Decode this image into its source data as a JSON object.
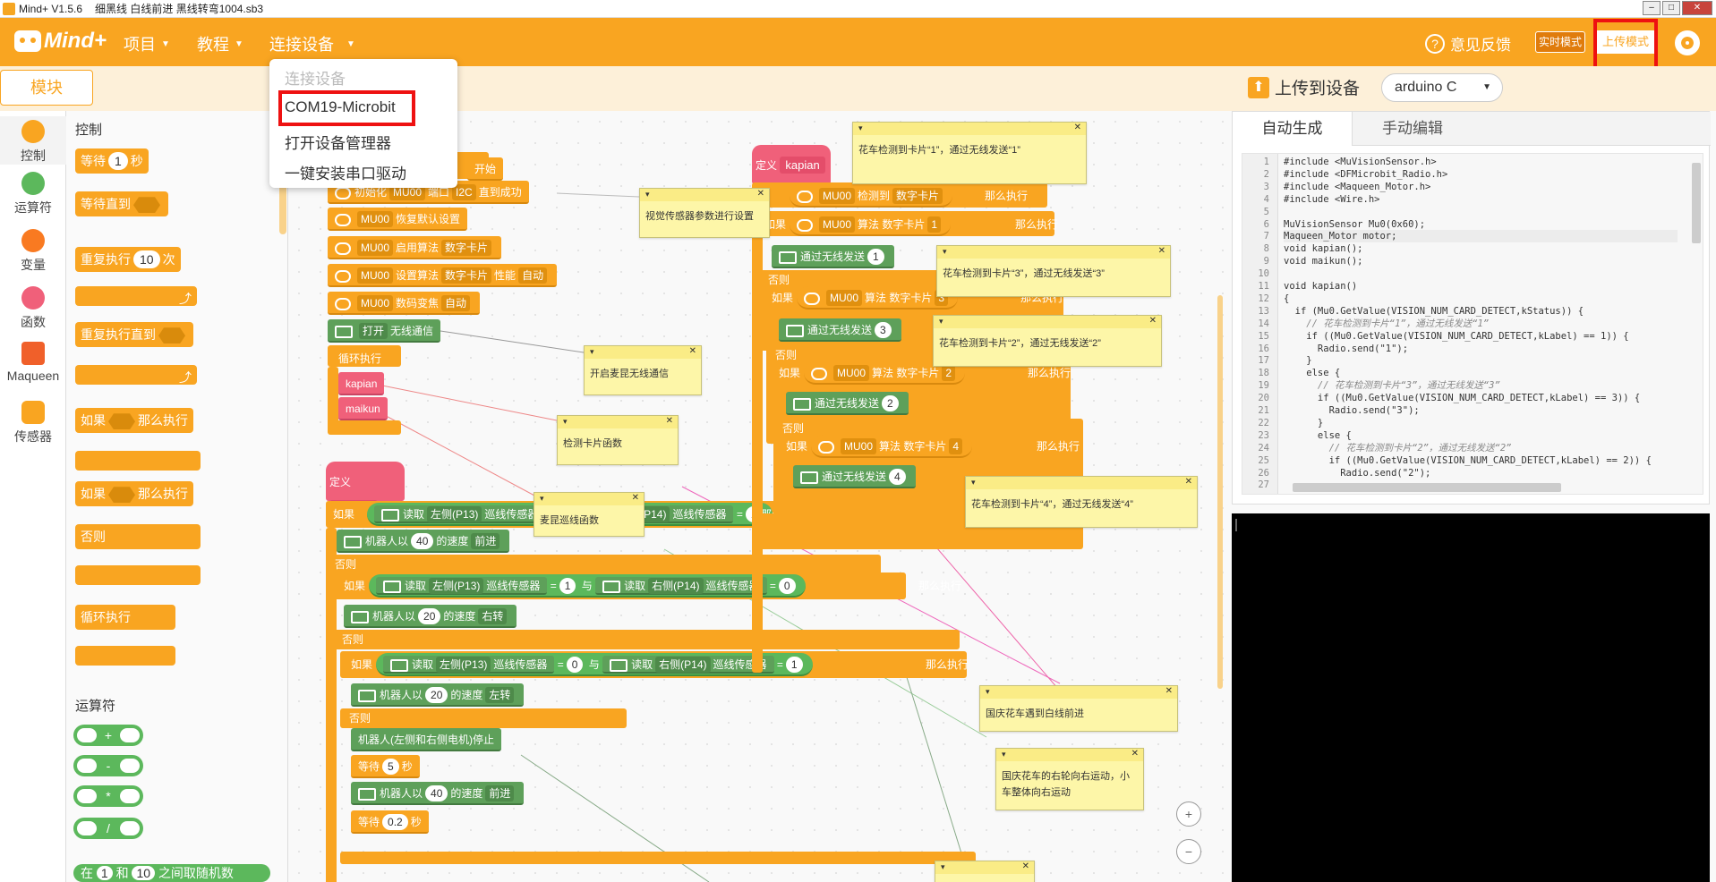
{
  "window": {
    "app": "Mind+ V1.5.6",
    "file": "细黑线 白线前进 黑线转弯1004.sb3"
  },
  "topbar": {
    "logo": "Mind+",
    "menus": [
      "项目",
      "教程",
      "连接设备"
    ],
    "feedback": "意见反馈",
    "mode_realtime": "实时模式",
    "mode_upload": "上传模式"
  },
  "subbar": {
    "module_tab": "模块",
    "upload_label": "上传到设备",
    "device": "arduino C"
  },
  "device_menu": {
    "items": [
      "连接设备",
      "COM19-Microbit",
      "打开设备管理器",
      "一键安装串口驱动"
    ]
  },
  "categories": [
    {
      "label": "控制",
      "color": "#f9a521"
    },
    {
      "label": "运算符",
      "color": "#5cb85c"
    },
    {
      "label": "变量",
      "color": "#f97a21"
    },
    {
      "label": "函数",
      "color": "#f0607a"
    },
    {
      "label": "Maqueen",
      "color": "#f0602a"
    },
    {
      "label": "传感器",
      "color": "#f9a521"
    }
  ],
  "palette": {
    "control_title": "控制",
    "wait": "等待",
    "wait_val": "1",
    "wait_unit": "秒",
    "wait_until": "等待直到",
    "repeat": "重复执行",
    "repeat_val": "10",
    "repeat_unit": "次",
    "repeat_until": "重复执行直到",
    "if_then": "如果",
    "then": "那么执行",
    "if_else_if": "如果",
    "if_else_then": "那么执行",
    "else": "否则",
    "forever": "循环执行",
    "operators_title": "运算符",
    "ops": [
      "+",
      "-",
      "*",
      "/"
    ],
    "random": {
      "a": "在",
      "v1": "1",
      "and": "和",
      "v2": "10",
      "rest": "之间取随机数"
    }
  },
  "script": {
    "start": "开始",
    "init": "初始化",
    "mu": "MU00",
    "port_label": "端口",
    "port": "I2C",
    "until_ok": "直到成功",
    "restore": "恢复默认设置",
    "enable": "启用",
    "algo": "算法",
    "card_num": "数字卡片",
    "set_algo": "设置算法",
    "perf": "性能",
    "auto": "自动",
    "cam_gain": "数码变焦",
    "wireless_open": "打开",
    "wireless": "无线通信",
    "loop": "循环执行",
    "kapian": "kapian",
    "maikun": "maikun",
    "define": "定义",
    "if": "如果",
    "then": "那么执行",
    "else": "否则",
    "and": "与",
    "read": "读取",
    "left": "左侧(P13)",
    "right": "右侧(P14)",
    "line_sensor": "巡线传感器",
    "eq": "=",
    "one": "1",
    "zero": "0",
    "robot_speed": "机器人以",
    "speed40": "40",
    "speed20": "20",
    "speed_unit": "的速度",
    "fwd": "前进",
    "rturn": "右转",
    "lturn": "左转",
    "stop": "机器人(左侧和右侧电机)停止",
    "wait": "等待",
    "w5": "5",
    "w02": "0.2",
    "sec": "秒",
    "detect": "检测到",
    "card_label": "数字卡片",
    "send": "通过无线发送",
    "n1": "1",
    "n2": "2",
    "n3": "3",
    "n4": "4"
  },
  "notes": {
    "n1": "花车检测到卡片“1”，通过无线发送“1”",
    "n2": "视觉传感器参数进行设置",
    "n3": "花车检测到卡片“3”，通过无线发送“3”",
    "n4": "花车检测到卡片“2”，通过无线发送“2”",
    "n5": "开启麦昆无线通信",
    "n6": "检测卡片函数",
    "n7": "麦昆巡线函数",
    "n8": "花车检测到卡片“4”，通过无线发送“4”",
    "n9": "国庆花车遇到白线前进",
    "n10": "国庆花车的右轮向右运动，小车整体向右运动"
  },
  "editor": {
    "tab_auto": "自动生成",
    "tab_manual": "手动编辑",
    "lines": [
      {
        "n": "1",
        "t": "#include <MuVisionSensor.h>"
      },
      {
        "n": "2",
        "t": "#include <DFMicrobit_Radio.h>"
      },
      {
        "n": "3",
        "t": "#include <Maqueen_Motor.h>"
      },
      {
        "n": "4",
        "t": "#include <Wire.h>"
      },
      {
        "n": "5",
        "t": ""
      },
      {
        "n": "6",
        "t": "MuVisionSensor Mu0(0x60);"
      },
      {
        "n": "7",
        "t": "Maqueen_Motor motor;"
      },
      {
        "n": "8",
        "t": "void kapian();"
      },
      {
        "n": "9",
        "t": "void maikun();"
      },
      {
        "n": "10",
        "t": ""
      },
      {
        "n": "11",
        "t": "void kapian()"
      },
      {
        "n": "12",
        "t": "{"
      },
      {
        "n": "13",
        "t": "  if (Mu0.GetValue(VISION_NUM_CARD_DETECT,kStatus)) {"
      },
      {
        "n": "14",
        "t": "    // 花车检测到卡片“1”，通过无线发送“1”"
      },
      {
        "n": "15",
        "t": "    if ((Mu0.GetValue(VISION_NUM_CARD_DETECT,kLabel) == 1)) {"
      },
      {
        "n": "16",
        "t": "      Radio.send(\"1\");"
      },
      {
        "n": "17",
        "t": "    }"
      },
      {
        "n": "18",
        "t": "    else {"
      },
      {
        "n": "19",
        "t": "      // 花车检测到卡片“3”，通过无线发送“3”"
      },
      {
        "n": "20",
        "t": "      if ((Mu0.GetValue(VISION_NUM_CARD_DETECT,kLabel) == 3)) {"
      },
      {
        "n": "21",
        "t": "        Radio.send(\"3\");"
      },
      {
        "n": "22",
        "t": "      }"
      },
      {
        "n": "23",
        "t": "      else {"
      },
      {
        "n": "24",
        "t": "        // 花车检测到卡片“2”，通过无线发送“2”"
      },
      {
        "n": "25",
        "t": "        if ((Mu0.GetValue(VISION_NUM_CARD_DETECT,kLabel) == 2)) {"
      },
      {
        "n": "26",
        "t": "          Radio.send(\"2\");"
      },
      {
        "n": "27",
        "t": ""
      }
    ]
  },
  "zoom": {
    "in": "+",
    "out": "−"
  }
}
